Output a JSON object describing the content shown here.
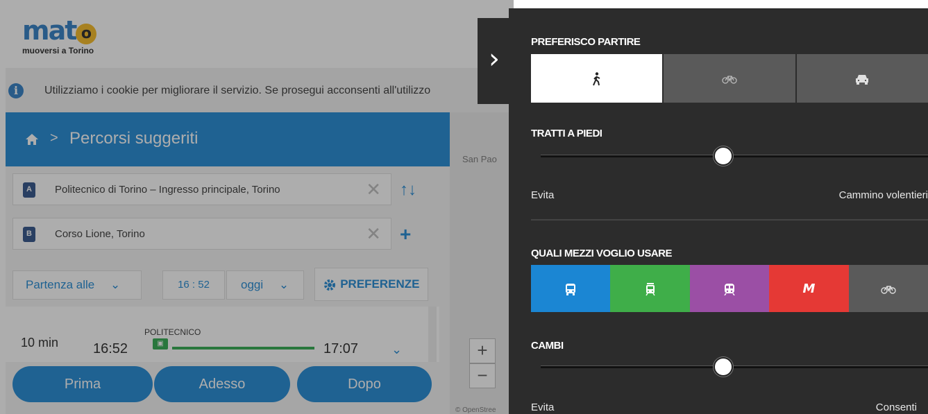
{
  "app": {
    "logo_word_start": "ma",
    "logo_word_end": "t",
    "logo_o": "o",
    "logo_tagline": "muoversi a Torino",
    "cookie_text": "Utilizziamo i cookie per migliorare il servizio. Se prosegui acconsenti all'utilizzo",
    "breadcrumb_sep": ">",
    "page_title": "Percorsi suggeriti",
    "from": {
      "pin": "A",
      "value": "Politecnico di Torino – Ingresso principale, Torino"
    },
    "to": {
      "pin": "B",
      "value": "Corso Lione, Torino"
    },
    "clear_glyph": "✕",
    "swap_glyph": "↑↓",
    "add_glyph": "+",
    "departure_mode": "Partenza alle",
    "dropdown_glyph": "⌄",
    "time": "16 : 52",
    "day": "oggi",
    "preferences_label": "PREFERENZE",
    "result": {
      "duration": "10 min",
      "depart": "16:52",
      "stop": "POLITECNICO",
      "arrive": "17:07",
      "expand_glyph": "⌄"
    },
    "buttons": {
      "prev": "Prima",
      "now": "Adesso",
      "next": "Dopo"
    },
    "map": {
      "label": "San Pao",
      "zoom_in": "+",
      "zoom_out": "−",
      "attribution": "© OpenStree"
    }
  },
  "panel": {
    "collapse_glyph": "›",
    "departure": {
      "title": "PREFERISCO PARTIRE",
      "options": [
        {
          "icon": "walk-icon",
          "selected": true
        },
        {
          "icon": "bike-icon",
          "selected": false
        },
        {
          "icon": "car-icon",
          "selected": false
        }
      ]
    },
    "walking": {
      "title": "TRATTI A PIEDI",
      "min_label": "Evita",
      "max_label": "Cammino volentieri",
      "value": 0.47
    },
    "modes": {
      "title": "QUALI MEZZI VOGLIO USARE",
      "metro_letter": "M",
      "items": [
        {
          "icon": "bus-icon",
          "color": "#1b86d3"
        },
        {
          "icon": "tram-icon",
          "color": "#3fae49"
        },
        {
          "icon": "train-icon",
          "color": "#9b4fa5"
        },
        {
          "icon": "metro-icon",
          "color": "#e53935"
        },
        {
          "icon": "bike-icon",
          "color": "#5a5a5a"
        }
      ]
    },
    "changes": {
      "title": "CAMBI",
      "min_label": "Evita",
      "max_label": "Consenti",
      "value": 0.47
    }
  }
}
